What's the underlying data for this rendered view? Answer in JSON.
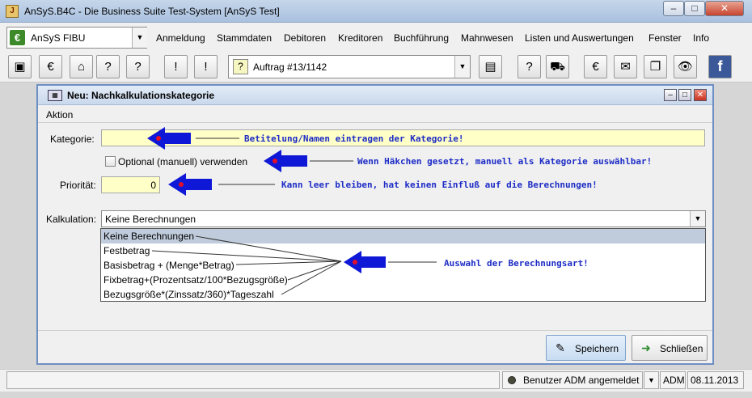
{
  "window": {
    "title": "AnSyS.B4C - Die Business Suite Test-System [AnSyS Test]",
    "app_icon": "java-cup-icon",
    "controls": [
      "minimize",
      "maximize",
      "close"
    ]
  },
  "app_selector": {
    "value": "AnSyS FIBU",
    "icon": "euro-icon"
  },
  "menu": [
    "Anmeldung",
    "Stammdaten",
    "Debitoren",
    "Kreditoren",
    "Buchführung",
    "Mahnwesen",
    "Listen und Auswertungen",
    "Fenster",
    "Info"
  ],
  "toolbar": {
    "order_select": "Auftrag #13/1142",
    "icons": [
      "cube-icon",
      "euro-stack-icon",
      "house-icon",
      "help-icon",
      "help-arrow-icon",
      "help-exclaim-icon",
      "help-arrow2-icon",
      "book-icon",
      "help-hand-icon",
      "truck-icon",
      "euro-cycle-icon",
      "mail-icon",
      "copy-icon",
      "eye-check-icon",
      "facebook-icon"
    ]
  },
  "dialog": {
    "title": "Neu: Nachkalkulationskategorie",
    "menu": "Aktion",
    "fields": {
      "kategorie_label": "Kategorie:",
      "kategorie_value": "",
      "optional_label": "Optional (manuell) verwenden",
      "optional_checked": false,
      "prioritaet_label": "Priorität:",
      "prioritaet_value": "0",
      "kalkulation_label": "Kalkulation:",
      "kalkulation_value": "Keine Berechnungen"
    },
    "kalkulation_options": [
      "Keine Berechnungen",
      "Festbetrag",
      "Basisbetrag + (Menge*Betrag)",
      "Fixbetrag+(Prozentsatz/100*Bezugsgröße)",
      "Bezugsgröße*(Zinssatz/360)*Tageszahl"
    ],
    "annotations": {
      "kategorie": "Betitelung/Namen eintragen der Kategorie!",
      "optional": "Wenn Häkchen gesetzt, manuell als Kategorie auswählbar!",
      "prioritaet": "Kann leer bleiben, hat keinen Einfluß auf die Berechnungen!",
      "kalkulation": "Auswahl der Berechnungsart!"
    },
    "buttons": {
      "save": "Speichern",
      "close": "Schließen"
    }
  },
  "statusbar": {
    "user": "Benutzer ADM angemeldet",
    "user_short": "ADM",
    "date": "08.11.2013"
  },
  "colors": {
    "annotation": "#1d2cc6",
    "arrow": "#0f18d6",
    "yellow_field": "#ffffc8",
    "desktop": "#6d8fb8"
  }
}
